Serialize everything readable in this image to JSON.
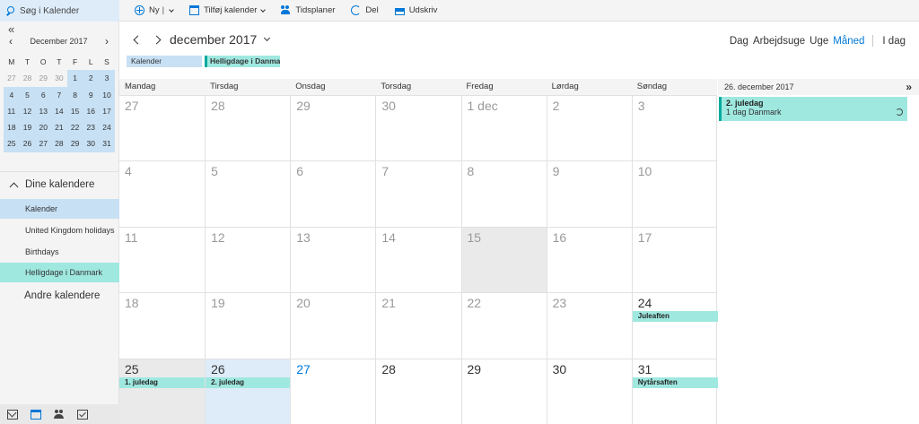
{
  "search": {
    "placeholder": "Søg i Kalender"
  },
  "sidebar": {
    "collapse_glyph": "«",
    "mini_calendar": {
      "title": "December 2017",
      "prev_glyph": "‹",
      "next_glyph": "›",
      "weekdays": [
        "M",
        "T",
        "O",
        "T",
        "F",
        "L",
        "S"
      ],
      "weeks": [
        [
          "27",
          "28",
          "29",
          "30",
          "1",
          "2",
          "3"
        ],
        [
          "4",
          "5",
          "6",
          "7",
          "8",
          "9",
          "10"
        ],
        [
          "11",
          "12",
          "13",
          "14",
          "15",
          "16",
          "17"
        ],
        [
          "18",
          "19",
          "20",
          "21",
          "22",
          "23",
          "24"
        ],
        [
          "25",
          "26",
          "27",
          "28",
          "29",
          "30",
          "31"
        ]
      ]
    },
    "my_calendars_label": "Dine kalendere",
    "calendars": [
      "Kalender",
      "United Kingdom holidays",
      "Birthdays",
      "Helligdage i Danmark"
    ],
    "other_calendars_label": "Andre kalendere"
  },
  "toolbar": {
    "new_label": "Ny",
    "pipe": "|",
    "add_calendar_label": "Tilføj kalender",
    "schedules_label": "Tidsplaner",
    "share_label": "Del",
    "print_label": "Udskriv"
  },
  "header": {
    "month_title": "december 2017",
    "views": [
      "Dag",
      "Arbejdsuge",
      "Uge",
      "Måned"
    ],
    "active_view": "Måned",
    "today_label": "I dag"
  },
  "chips": {
    "kalender": "Kalender",
    "helligdage": "Helligdage i Danmark"
  },
  "grid": {
    "weekdays": [
      "Mandag",
      "Tirsdag",
      "Onsdag",
      "Torsdag",
      "Fredag",
      "Lørdag",
      "Søndag"
    ],
    "weeks": [
      [
        "27",
        "28",
        "29",
        "30",
        "1 dec",
        "2",
        "3"
      ],
      [
        "4",
        "5",
        "6",
        "7",
        "8",
        "9",
        "10"
      ],
      [
        "11",
        "12",
        "13",
        "14",
        "15",
        "16",
        "17"
      ],
      [
        "18",
        "19",
        "20",
        "21",
        "22",
        "23",
        "24"
      ],
      [
        "25",
        "26",
        "27",
        "28",
        "29",
        "30",
        "31"
      ]
    ],
    "events": {
      "juleaften": "Juleaften",
      "juledag1": "1. juledag",
      "juledag2": "2. juledag",
      "nytaarsaften": "Nytårsaften"
    }
  },
  "agenda": {
    "date": "26. december 2017",
    "expand_glyph": "»",
    "event_title": "2. juledag",
    "event_sub": "1 dag  Danmark"
  },
  "colors": {
    "accent": "#0078d7",
    "holiday": "#9fe8e0",
    "selected": "#c7e0f4"
  }
}
